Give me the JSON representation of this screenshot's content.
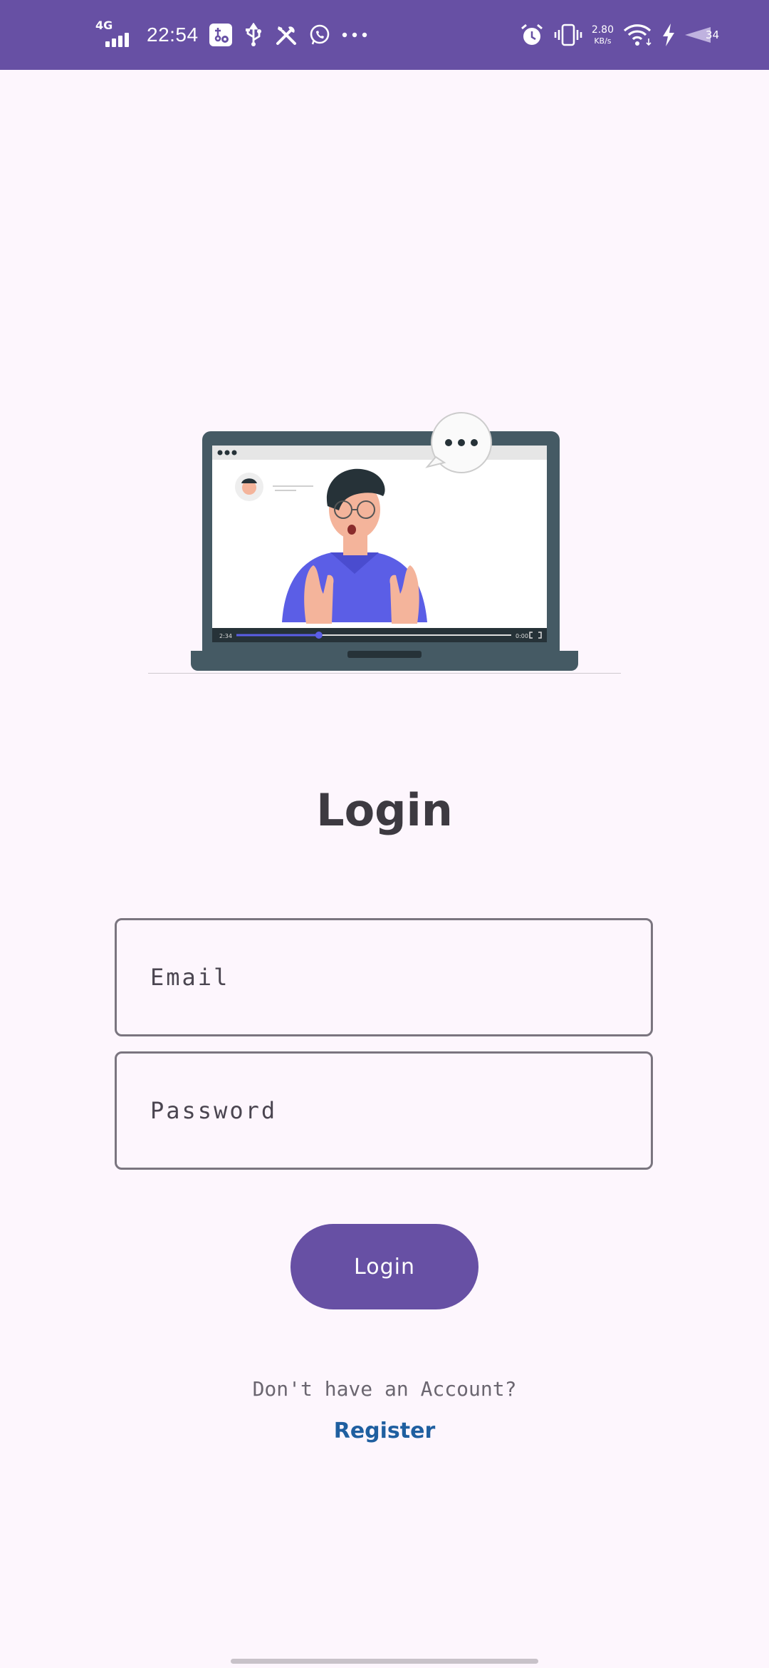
{
  "status_bar": {
    "network": "4G",
    "time": "22:54",
    "speed_value": "2.80",
    "speed_unit": "KB/s",
    "battery": "34",
    "left_icons": [
      "usb-settings-icon",
      "usb-icon",
      "tools-icon",
      "whatsapp-icon",
      "more-dots-icon"
    ],
    "right_icons": [
      "alarm-icon",
      "vibrate-icon",
      "wifi-icon",
      "charging-icon",
      "battery-icon"
    ]
  },
  "illustration": {
    "player_elapsed": "2:34",
    "player_total": "0:00",
    "player_progress": 0.3
  },
  "page": {
    "title": "Login"
  },
  "form": {
    "email_placeholder": "Email",
    "password_placeholder": "Password",
    "login_button": "Login"
  },
  "footer": {
    "prompt": "Don't have an Account?",
    "register_link": "Register"
  },
  "colors": {
    "primary": "#6750a4",
    "background": "#fdf6fd",
    "link": "#1f5fa0"
  }
}
